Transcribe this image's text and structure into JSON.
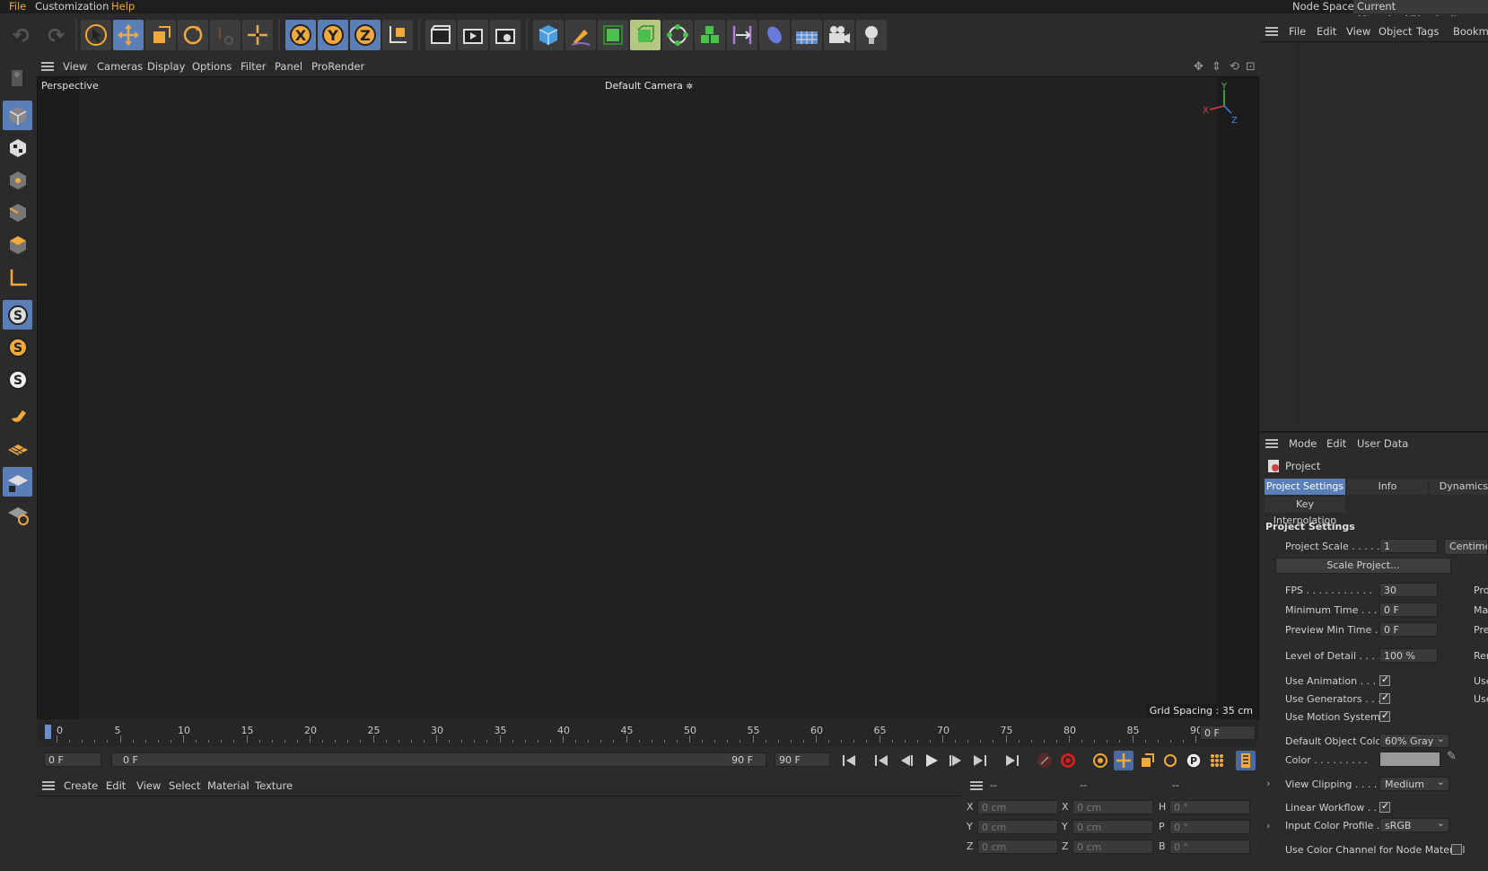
{
  "menubar": {
    "items": [
      {
        "label": "File",
        "accent": true
      },
      {
        "label": "Customization",
        "accent": false
      },
      {
        "label": "Help",
        "accent": true
      }
    ],
    "node_space_label": "Node Space:",
    "node_space_value": "Current (Standard/Physical)"
  },
  "toolbar": {
    "icons": [
      "undo-icon",
      "redo-icon",
      "select-arrow-icon",
      "move-icon",
      "scale-icon",
      "rotate-icon",
      "recent-tools-icon",
      "live-selection-icon",
      "x-axis-icon",
      "y-axis-icon",
      "z-axis-icon",
      "coordinate-system-icon",
      "render-view-icon",
      "render-picture-viewer-icon",
      "render-settings-icon",
      "cube-icon",
      "pen-icon",
      "subdivision-icon",
      "extrude-icon",
      "cloner-icon",
      "array-icon",
      "deformer-icon",
      "field-icon",
      "floor-icon",
      "camera-icon",
      "light-icon"
    ]
  },
  "viewport_menu": {
    "items": [
      "View",
      "Cameras",
      "Display",
      "Options",
      "Filter",
      "Panel",
      "ProRender"
    ],
    "accent_item": "Options"
  },
  "viewport": {
    "view_name": "Perspective",
    "camera_name": "Default Camera",
    "grid_spacing": "Grid Spacing : 35 cm",
    "axis_x": "X",
    "axis_y": "Y",
    "axis_z": "Z"
  },
  "timeline": {
    "ticks": [
      "0",
      "5",
      "10",
      "15",
      "20",
      "25",
      "30",
      "35",
      "40",
      "45",
      "50",
      "55",
      "60",
      "65",
      "70",
      "75",
      "80",
      "85",
      "90"
    ],
    "current_frame": "0 F"
  },
  "playbar": {
    "start_field": "0 F",
    "range_start": "0 F",
    "range_end": "90 F",
    "end_field": "90 F"
  },
  "material_menu": {
    "items": [
      "Create",
      "Edit",
      "View",
      "Select",
      "Material",
      "Texture"
    ],
    "accent_items": [
      "Create",
      "Edit"
    ]
  },
  "coords": {
    "headers": [
      "--",
      "--",
      "--"
    ],
    "rows": [
      {
        "a": "X",
        "av": "0 cm",
        "b": "X",
        "bv": "0 cm",
        "c": "H",
        "cv": "0 °"
      },
      {
        "a": "Y",
        "av": "0 cm",
        "b": "Y",
        "bv": "0 cm",
        "c": "P",
        "cv": "0 °"
      },
      {
        "a": "Z",
        "av": "0 cm",
        "b": "Z",
        "bv": "0 cm",
        "c": "B",
        "cv": "0 °"
      }
    ]
  },
  "object_manager_menu": {
    "items": [
      "File",
      "Edit",
      "View",
      "Object",
      "Tags",
      "Bookma"
    ]
  },
  "attributes": {
    "menu": [
      "Mode",
      "Edit",
      "User Data"
    ],
    "object_name": "Project",
    "tabs": [
      "Project Settings",
      "Info",
      "Dynamics",
      "Key Interpolation"
    ],
    "section": "Project Settings",
    "project_scale_label": "Project Scale . . . . .",
    "project_scale_value": "1",
    "project_scale_unit": "Centime",
    "scale_project_button": "Scale Project...",
    "fps_label": "FPS . . . . . . . . . . .",
    "fps_value": "30",
    "min_time_label": "Minimum Time . . .",
    "min_time_value": "0 F",
    "preview_min_label": "Preview Min Time . .",
    "preview_min_value": "0 F",
    "lod_label": "Level of Detail . . . .",
    "lod_value": "100 %",
    "right_cut": [
      "Pro",
      "Ma",
      "Pre",
      "Ren",
      "Use",
      "Use"
    ],
    "use_animation": "Use Animation . . . .",
    "use_generators": "Use Generators . . .",
    "use_motion": "Use Motion System",
    "default_color_label": "Default Object Color",
    "default_color_value": "60% Gray",
    "color_label": "Color . . . . . . . . .",
    "view_clipping_label": "View Clipping . . . .",
    "view_clipping_value": "Medium",
    "linear_workflow": "Linear Workflow . . .",
    "input_profile_label": "Input Color Profile .",
    "input_profile_value": "sRGB",
    "use_color_channel": "Use Color Channel for Node Material"
  },
  "colors": {
    "accent": "#f2a93b",
    "highlight": "#5a7fb8",
    "background": "#2b2b2b",
    "viewport": "#222222"
  }
}
